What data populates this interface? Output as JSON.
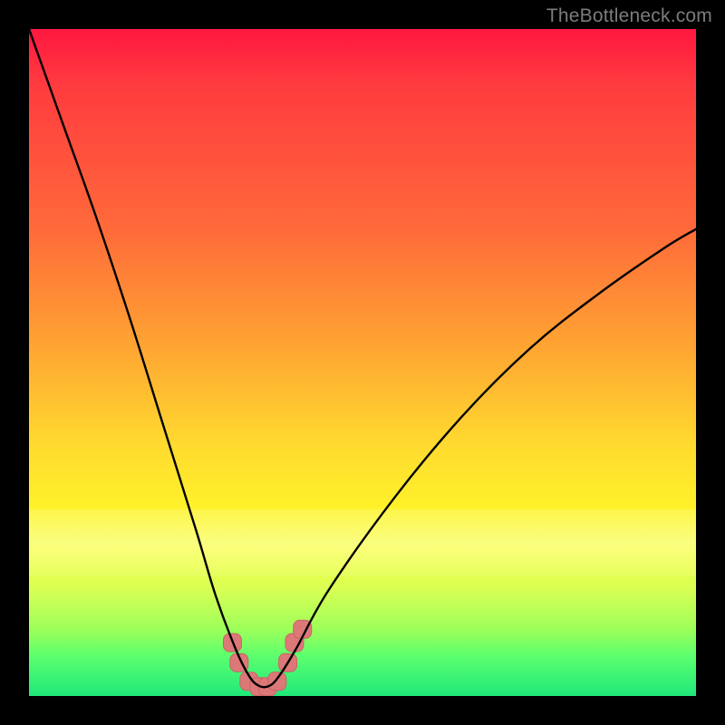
{
  "watermark": {
    "text": "TheBottleneck.com"
  },
  "colors": {
    "curve_stroke": "#000000",
    "cluster_fill": "#dd7878",
    "cluster_stroke": "#c96464"
  },
  "chart_data": {
    "type": "line",
    "title": "",
    "xlabel": "",
    "ylabel": "",
    "xlim": [
      0,
      100
    ],
    "ylim": [
      0,
      100
    ],
    "grid": false,
    "series": [
      {
        "name": "bottleneck-curve",
        "x": [
          0,
          5,
          10,
          15,
          20,
          25,
          28,
          31,
          33,
          34.5,
          36,
          37.5,
          40,
          45,
          55,
          65,
          75,
          85,
          95,
          100
        ],
        "y": [
          100,
          86,
          72,
          57,
          41,
          25,
          15,
          7,
          3,
          1.5,
          1.5,
          3,
          7,
          16,
          30,
          42,
          52,
          60,
          67,
          70
        ]
      }
    ],
    "cluster_points": {
      "name": "highlighted-bottom-points",
      "points": [
        {
          "x": 30.5,
          "y": 8
        },
        {
          "x": 31.5,
          "y": 5
        },
        {
          "x": 33.0,
          "y": 2.2
        },
        {
          "x": 34.5,
          "y": 1.4
        },
        {
          "x": 35.8,
          "y": 1.4
        },
        {
          "x": 37.2,
          "y": 2.2
        },
        {
          "x": 38.8,
          "y": 5
        },
        {
          "x": 39.8,
          "y": 8
        },
        {
          "x": 41.0,
          "y": 10
        }
      ]
    }
  }
}
